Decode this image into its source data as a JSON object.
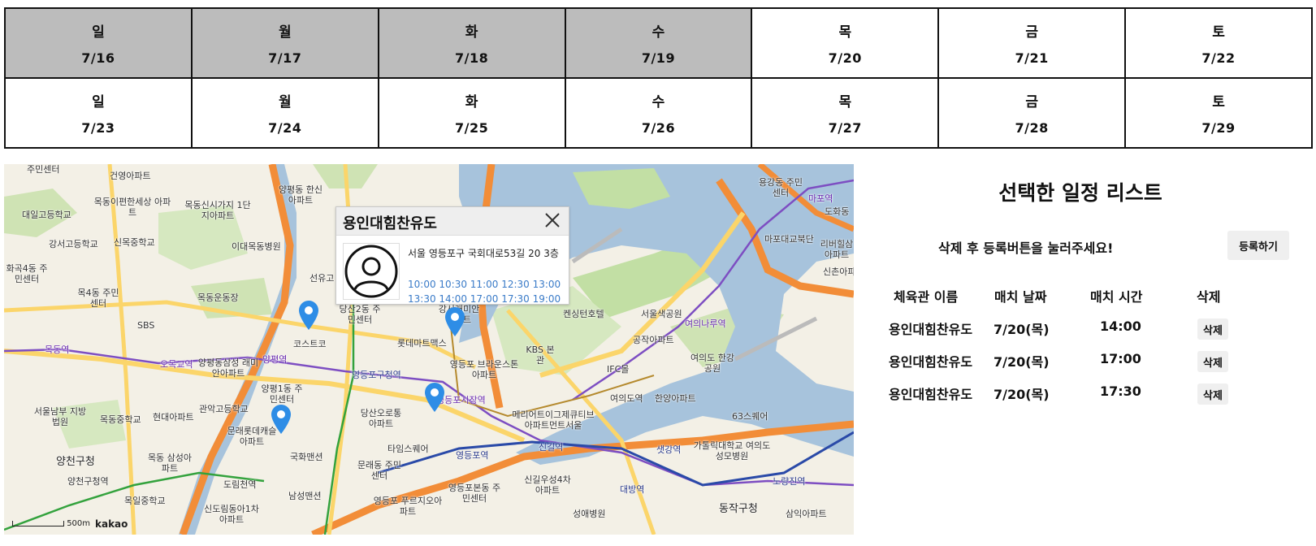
{
  "calendar": {
    "weeks": [
      [
        {
          "dow": "일",
          "date": "7/16",
          "past": true
        },
        {
          "dow": "월",
          "date": "7/17",
          "past": true
        },
        {
          "dow": "화",
          "date": "7/18",
          "past": true
        },
        {
          "dow": "수",
          "date": "7/19",
          "past": true
        },
        {
          "dow": "목",
          "date": "7/20",
          "past": false
        },
        {
          "dow": "금",
          "date": "7/21",
          "past": false
        },
        {
          "dow": "토",
          "date": "7/22",
          "past": false
        }
      ],
      [
        {
          "dow": "일",
          "date": "7/23",
          "past": false
        },
        {
          "dow": "월",
          "date": "7/24",
          "past": false
        },
        {
          "dow": "화",
          "date": "7/25",
          "past": false
        },
        {
          "dow": "수",
          "date": "7/26",
          "past": false
        },
        {
          "dow": "목",
          "date": "7/27",
          "past": false
        },
        {
          "dow": "금",
          "date": "7/28",
          "past": false
        },
        {
          "dow": "토",
          "date": "7/29",
          "past": false
        }
      ]
    ],
    "past_color": "#bcbcbc"
  },
  "map": {
    "popup": {
      "title": "용인대힘찬유도",
      "address": "서울 영등포구 국회대로53길 20 3층",
      "times": "10:00 10:30 11:00 12:30 13:00 13:30 14:00 17:00 17:30 19:00"
    },
    "scale_label": "500m",
    "provider": "kakao",
    "labels": {
      "l1": "주민센터",
      "l2": "건영아파트",
      "l3": "목동이편한세상 아파트",
      "l4": "목동신시가지 1단지아파트",
      "l5": "양평동 한신아파트",
      "l6": "대일고등학교",
      "l7": "강서고등학교",
      "l8": "신목중학교",
      "l9": "이대목동병원",
      "l10": "화곡4동 주민센터",
      "l11": "목4동 주민센터",
      "l12": "목동운동장",
      "l13": "SBS",
      "l14": "선유고",
      "l15": "당산2동 주민센터",
      "l16": "코스트코",
      "l17": "강서래미안 아파트",
      "l18": "롯데마트맥스",
      "l19": "영등포 브라운스톤아파트",
      "l20": "영등포구청역",
      "l21": "오목교역",
      "l22": "양평동삼성 래미안아파트",
      "l23": "양평역",
      "l24": "양평1동 주민센터",
      "l25": "목동중학교",
      "l26": "관악고등학교",
      "l27": "현대아파트",
      "l28": "문래롯데캐슬 아파트",
      "l29": "서울남부 지방법원",
      "l30": "양천구청",
      "l31": "목동 삼성아파트",
      "l32": "국화맨션",
      "l33": "문래동 주민센터",
      "l34": "당산오로통 아파트",
      "l35": "타임스퀘어",
      "l36": "영등포역",
      "l37": "영등포시장역",
      "l38": "메리어트이그제큐티브 아파트먼트서울",
      "l39": "신길역",
      "l40": "영등포본동 주민센터",
      "l41": "신길우성4차 아파트",
      "l42": "영등포 푸르지오아파트",
      "l43": "남성맨션",
      "l44": "신도림동아1차 아파트",
      "l45": "목일중학교",
      "l46": "양천구청역",
      "l47": "도림천역",
      "l48": "켄싱턴호텔",
      "l49": "KBS 본관",
      "l50": "IFC몰",
      "l51": "여의도역",
      "l52": "한양아파트",
      "l53": "서울색공원",
      "l54": "공작아파트",
      "l55": "여의도 한강공원",
      "l56": "여의나루역",
      "l57": "63스퀘어",
      "l58": "샛강역",
      "l59": "가톨릭대학교 여의도성모병원",
      "l60": "노량진역",
      "l61": "대방역",
      "l62": "성애병원",
      "l63": "동작구청",
      "l64": "삼익아파트",
      "l65": "용강동 주민센터",
      "l66": "마포역",
      "l67": "마포대교북단",
      "l68": "리버힐삼 아파트",
      "l69": "신촌아파트",
      "l70": "도화동",
      "l71": "목동역"
    }
  },
  "panel": {
    "title": "선택한 일정 리스트",
    "notice": "삭제 후 등록버튼을 눌러주세요!",
    "register_label": "등록하기",
    "headers": {
      "gym": "체육관 이름",
      "date": "매치 날짜",
      "time": "매치 시간",
      "delete": "삭제"
    },
    "rows": [
      {
        "gym": "용인대힘찬유도",
        "date": "7/20(목)",
        "time": "14:00",
        "delete": "삭제"
      },
      {
        "gym": "용인대힘찬유도",
        "date": "7/20(목)",
        "time": "17:00",
        "delete": "삭제"
      },
      {
        "gym": "용인대힘찬유도",
        "date": "7/20(목)",
        "time": "17:30",
        "delete": "삭제"
      }
    ]
  }
}
